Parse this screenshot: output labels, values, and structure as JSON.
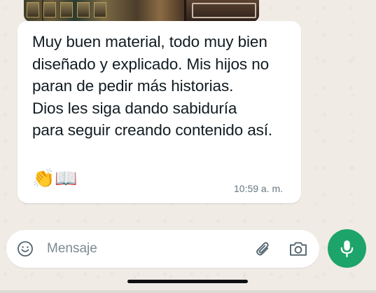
{
  "message": {
    "text": "Muy buen material, todo muy bien\ndiseñado y explicado. Mis hijos no\nparan de pedir más historias.\nDios les siga dando sabiduría\npara seguir creando contenido así.",
    "emojis": "👏📖",
    "time": "10:59 a. m."
  },
  "composer": {
    "placeholder": "Mensaje"
  },
  "icons": {
    "emoji": "emoji-icon",
    "attach": "paperclip-icon",
    "camera": "camera-icon",
    "mic": "microphone-icon"
  },
  "colors": {
    "background": "#efeae2",
    "bubble": "#ffffff",
    "accent": "#1da46b",
    "timestamp": "#667781"
  }
}
